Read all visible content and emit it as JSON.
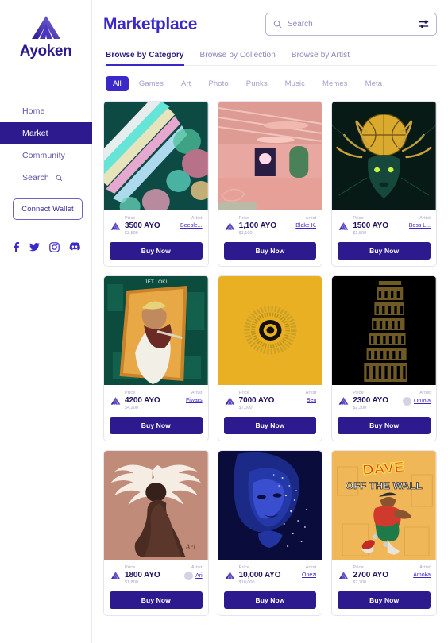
{
  "brand": {
    "name": "Ayoken",
    "logo_icon": "ayoken-triangle-logo"
  },
  "sidebar": {
    "nav": [
      {
        "label": "Home",
        "active": false,
        "icon": null
      },
      {
        "label": "Market",
        "active": true,
        "icon": null
      },
      {
        "label": "Community",
        "active": false,
        "icon": null
      },
      {
        "label": "Search",
        "active": false,
        "icon": "search-icon"
      }
    ],
    "wallet_button": "Connect Wallet",
    "socials": [
      {
        "name": "facebook-icon"
      },
      {
        "name": "twitter-icon"
      },
      {
        "name": "instagram-icon"
      },
      {
        "name": "discord-icon"
      }
    ]
  },
  "header": {
    "title": "Marketplace",
    "search": {
      "placeholder": "Search",
      "value": "",
      "icon": "search-icon",
      "filter_icon": "filter-sliders-icon"
    }
  },
  "tabs": [
    {
      "label": "Browse by Category",
      "active": true
    },
    {
      "label": "Browse by Collection",
      "active": false
    },
    {
      "label": "Browse by Artist",
      "active": false
    }
  ],
  "category_pills": [
    {
      "label": "All",
      "active": true
    },
    {
      "label": "Games",
      "active": false
    },
    {
      "label": "Art",
      "active": false
    },
    {
      "label": "Photo",
      "active": false
    },
    {
      "label": "Punks",
      "active": false
    },
    {
      "label": "Music",
      "active": false
    },
    {
      "label": "Memes",
      "active": false
    },
    {
      "label": "Meta",
      "active": false
    }
  ],
  "labels": {
    "price": "Price",
    "artist": "Artist",
    "buy": "Buy Now"
  },
  "colors": {
    "brand_purple": "#2e1a8f",
    "accent_blue": "#3b28c8",
    "muted_text": "#a8a3c9",
    "card_border": "#e6e4f1"
  },
  "cards": [
    {
      "price": "3500 AYO",
      "price_usd": "$3,500",
      "artist": "Beeple...",
      "art": "neon-light-streaks",
      "has_avatar": false
    },
    {
      "price": "1,100 AYO",
      "price_usd": "$1,100",
      "artist": "Blake K.",
      "art": "pink-interior-room",
      "has_avatar": false
    },
    {
      "price": "1500 AYO",
      "price_usd": "$1,500",
      "artist": "Boss L...",
      "art": "golden-deer-basketball",
      "has_avatar": false
    },
    {
      "price": "4200 AYO",
      "price_usd": "$4,200",
      "artist": "Fiwars",
      "art": "jet-loki-green-portrait",
      "has_avatar": false
    },
    {
      "price": "7000 AYO",
      "price_usd": "$7,000",
      "artist": "Ben",
      "art": "yellow-sunburst-eye",
      "has_avatar": false
    },
    {
      "price": "2300 AYO",
      "price_usd": "$2,300",
      "artist": "Oruola",
      "art": "black-leaning-tower",
      "has_avatar": true
    },
    {
      "price": "1800 AYO",
      "price_usd": "$1,800",
      "artist": "Ari",
      "art": "phoenix-woman-silhouette",
      "has_avatar": true
    },
    {
      "price": "10,000 AYO",
      "price_usd": "$10,000",
      "artist": "Onezi",
      "art": "blue-glitter-portrait",
      "has_avatar": false
    },
    {
      "price": "2700 AYO",
      "price_usd": "$2,700",
      "artist": "Amoka",
      "art": "dave-graffiti-skater",
      "has_avatar": false
    }
  ]
}
